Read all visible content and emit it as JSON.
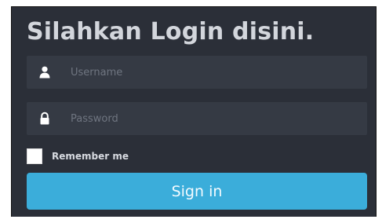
{
  "title": "Silahkan Login disini.",
  "username": {
    "icon": "user-icon",
    "placeholder": "Username",
    "value": ""
  },
  "password": {
    "icon": "lock-icon",
    "placeholder": "Password",
    "value": ""
  },
  "remember": {
    "label": "Remember me",
    "checked": false
  },
  "signin_label": "Sign in",
  "colors": {
    "panel_bg": "#2b2f38",
    "field_bg": "#353a44",
    "accent": "#3badda",
    "title_text": "#d3d6dc"
  }
}
